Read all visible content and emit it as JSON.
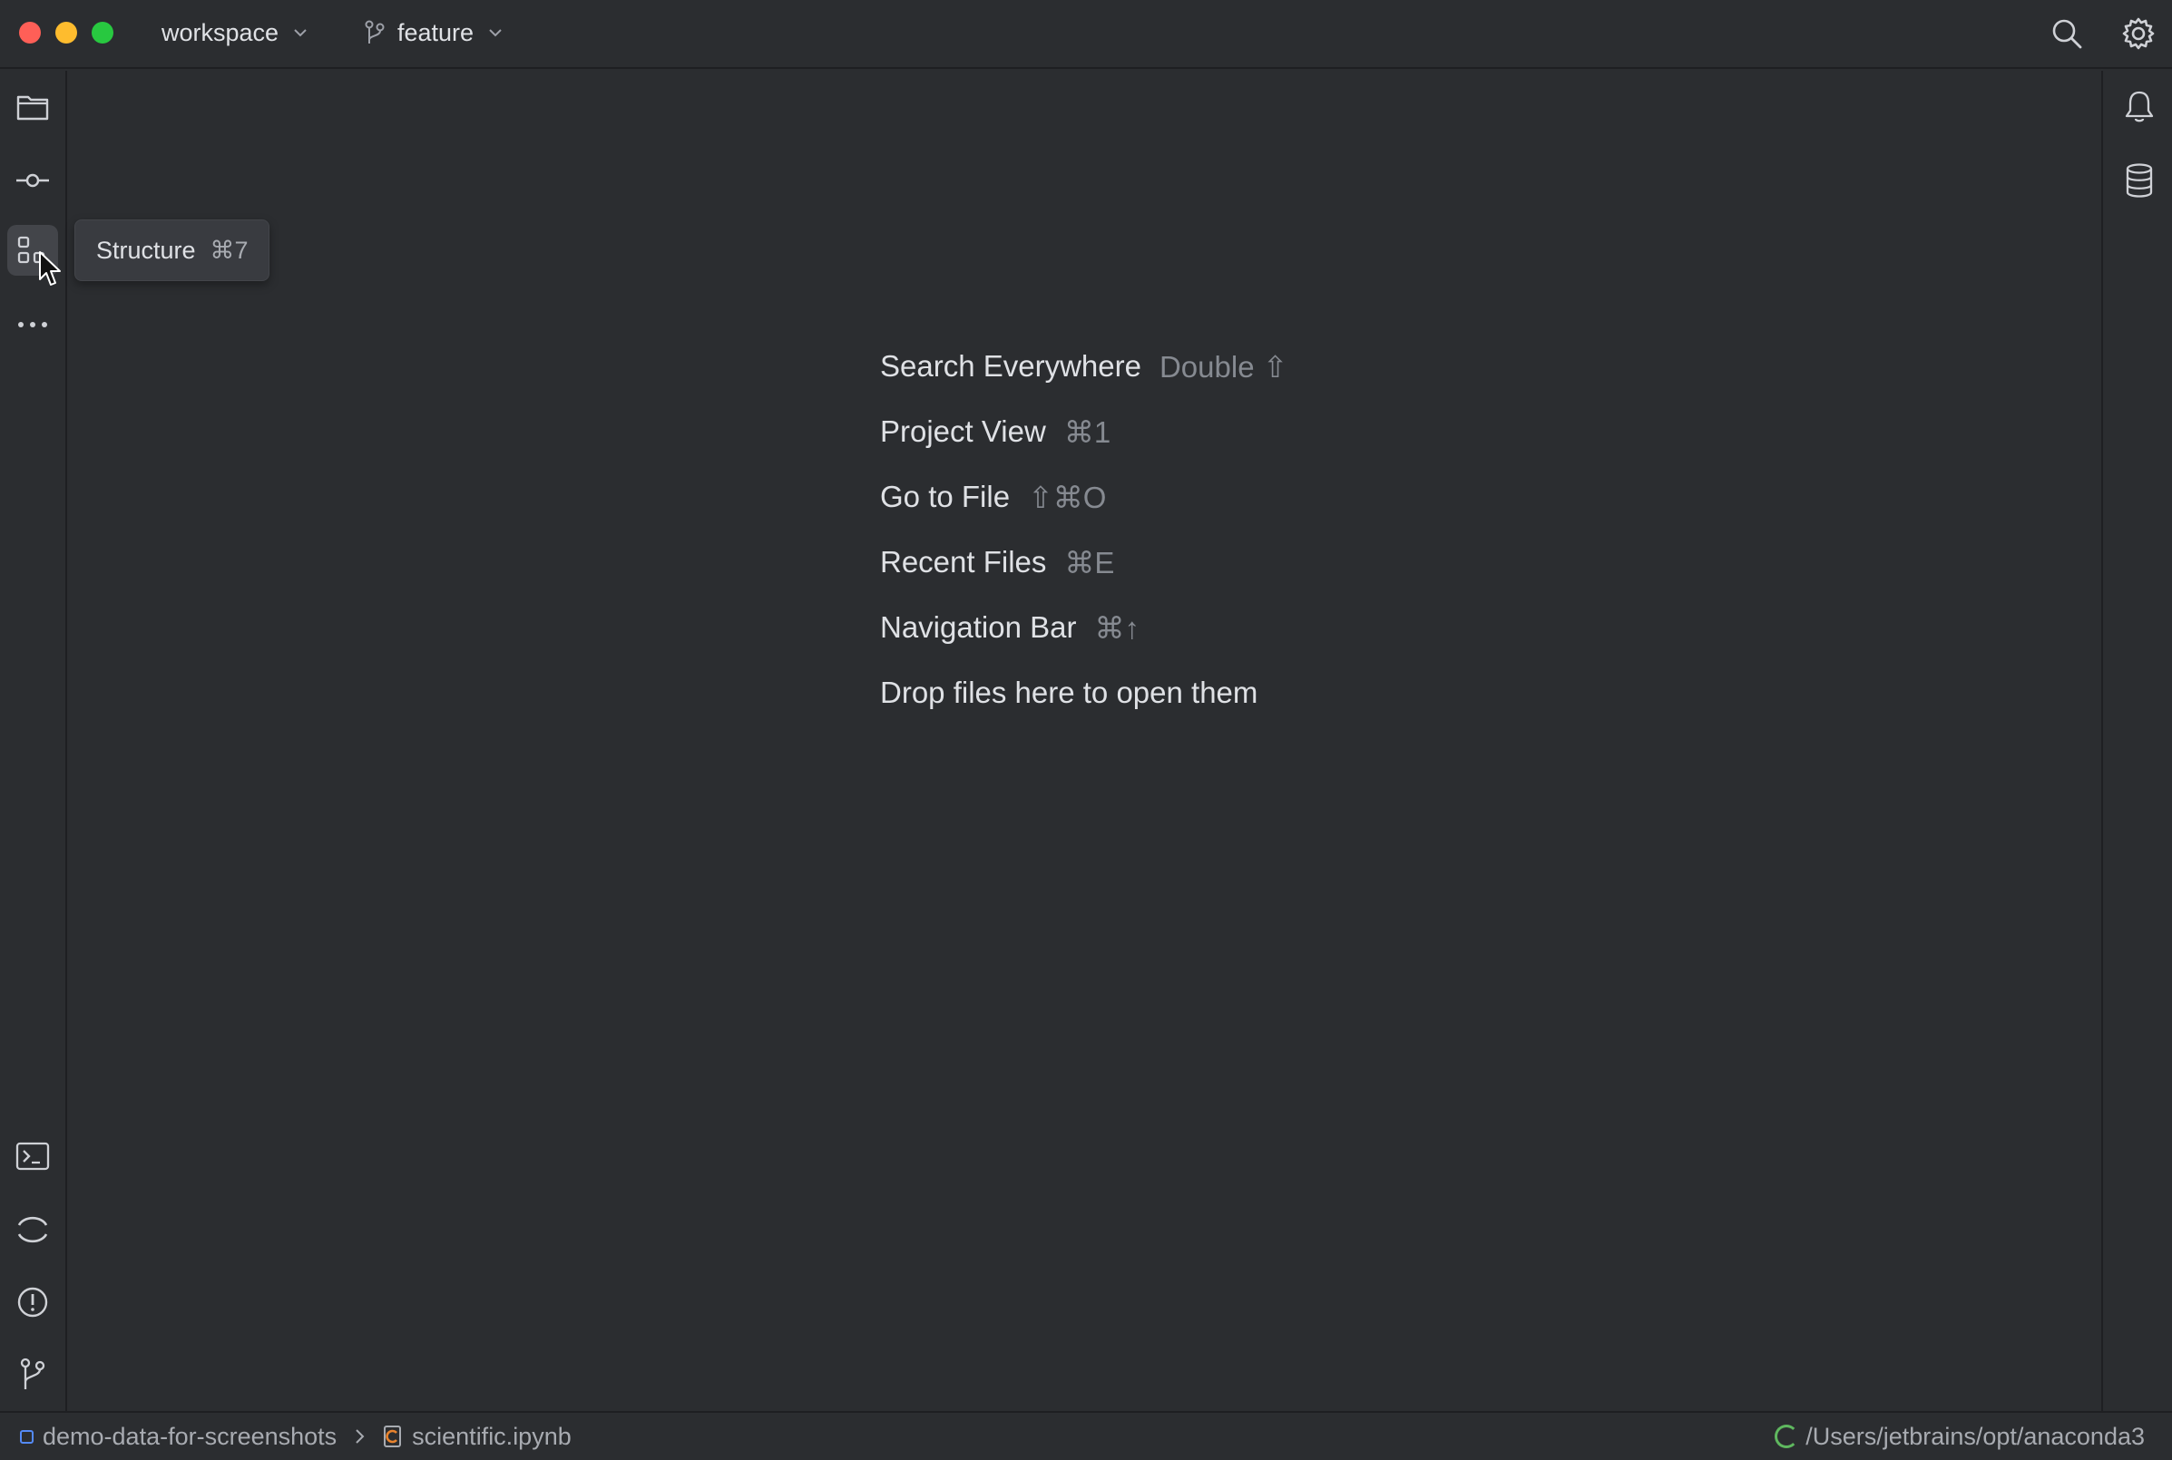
{
  "titlebar": {
    "project": "workspace",
    "branch": "feature"
  },
  "tooltip": {
    "label": "Structure",
    "shortcut": "⌘7"
  },
  "hints": [
    {
      "label": "Search Everywhere",
      "shortcut": "Double ⇧"
    },
    {
      "label": "Project View",
      "shortcut": "⌘1"
    },
    {
      "label": "Go to File",
      "shortcut": "⇧⌘O"
    },
    {
      "label": "Recent Files",
      "shortcut": "⌘E"
    },
    {
      "label": "Navigation Bar",
      "shortcut": "⌘↑"
    },
    {
      "label": "Drop files here to open them",
      "shortcut": ""
    }
  ],
  "statusbar": {
    "module": "demo-data-for-screenshots",
    "file": "scientific.ipynb",
    "interpreter": "/Users/jetbrains/opt/anaconda3"
  },
  "icons": {
    "left_top": [
      "folder-icon",
      "commit-icon",
      "structure-icon",
      "more-icon"
    ],
    "left_bottom": [
      "terminal-icon",
      "python-console-icon",
      "problems-icon",
      "git-icon"
    ],
    "right": [
      "notifications-icon",
      "database-icon"
    ]
  },
  "colors": {
    "background": "#2b2d30",
    "accent": "#548af7",
    "close": "#ff5f57",
    "minimize": "#febc2e",
    "maximize": "#28c840"
  }
}
